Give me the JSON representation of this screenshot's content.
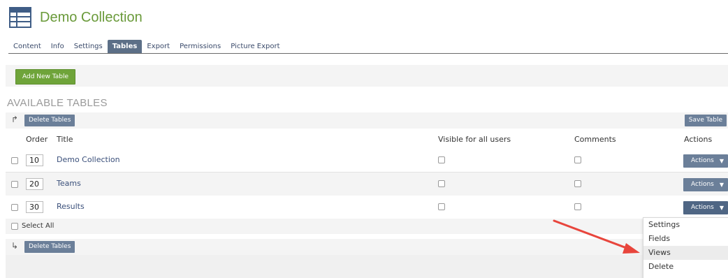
{
  "header": {
    "title": "Demo Collection",
    "icon": "table-icon"
  },
  "tabs": [
    {
      "label": "Content",
      "active": false
    },
    {
      "label": "Info",
      "active": false
    },
    {
      "label": "Settings",
      "active": false
    },
    {
      "label": "Tables",
      "active": true
    },
    {
      "label": "Export",
      "active": false
    },
    {
      "label": "Permissions",
      "active": false
    },
    {
      "label": "Picture Export",
      "active": false
    }
  ],
  "toolbar": {
    "add_table_label": "Add New Table"
  },
  "section": {
    "heading": "AVAILABLE TABLES"
  },
  "bar": {
    "delete_label": "Delete Tables",
    "save_label": "Save Table"
  },
  "table": {
    "columns": {
      "order": "Order",
      "title": "Title",
      "visible": "Visible for all users",
      "comments": "Comments",
      "actions": "Actions"
    },
    "rows": [
      {
        "order": "10",
        "title": "Demo Collection",
        "actions_label": "Actions"
      },
      {
        "order": "20",
        "title": "Teams",
        "actions_label": "Actions"
      },
      {
        "order": "30",
        "title": "Results",
        "actions_label": "Actions"
      }
    ],
    "select_all_label": "Select All"
  },
  "dropdown": {
    "items": [
      "Settings",
      "Fields",
      "Views",
      "Delete"
    ],
    "highlighted": "Views"
  },
  "colors": {
    "title_green": "#6a9a3a",
    "button_green": "#6fa43a",
    "slate": "#6b7f99",
    "active_tab": "#5c6f87",
    "link": "#3a4f7a",
    "annotation_arrow": "#e8453c"
  }
}
